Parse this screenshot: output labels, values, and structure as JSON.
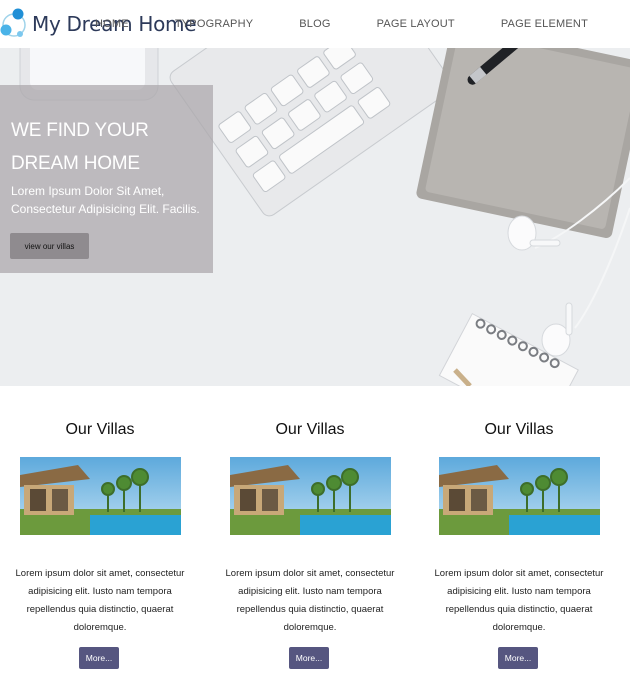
{
  "header": {
    "logo_text": "My Dream Home",
    "nav": [
      "HOME",
      "TYPOGRAPHY",
      "BLOG",
      "PAGE LAYOUT",
      "PAGE ELEMENT"
    ]
  },
  "hero": {
    "title": "WE FIND YOUR DREAM HOME",
    "subtitle": "Lorem Ipsum Dolor Sit Amet, Consectetur Adipisicing Elit. Facilis.",
    "button_label": "view our villas"
  },
  "villas": [
    {
      "title": "Our Villas",
      "text": "Lorem ipsum dolor sit amet, consectetur adipisicing elit. Iusto nam tempora repellendus quia distinctio, quaerat doloremque.",
      "button_label": "More..."
    },
    {
      "title": "Our Villas",
      "text": "Lorem ipsum dolor sit amet, consectetur adipisicing elit. Iusto nam tempora repellendus quia distinctio, quaerat doloremque.",
      "button_label": "More..."
    },
    {
      "title": "Our Villas",
      "text": "Lorem ipsum dolor sit amet, consectetur adipisicing elit. Iusto nam tempora repellendus quia distinctio, quaerat doloremque.",
      "button_label": "More..."
    }
  ],
  "colors": {
    "brand_text": "#2d3a5a",
    "more_button": "#565680",
    "hero_panel": "#aaa6aa"
  }
}
